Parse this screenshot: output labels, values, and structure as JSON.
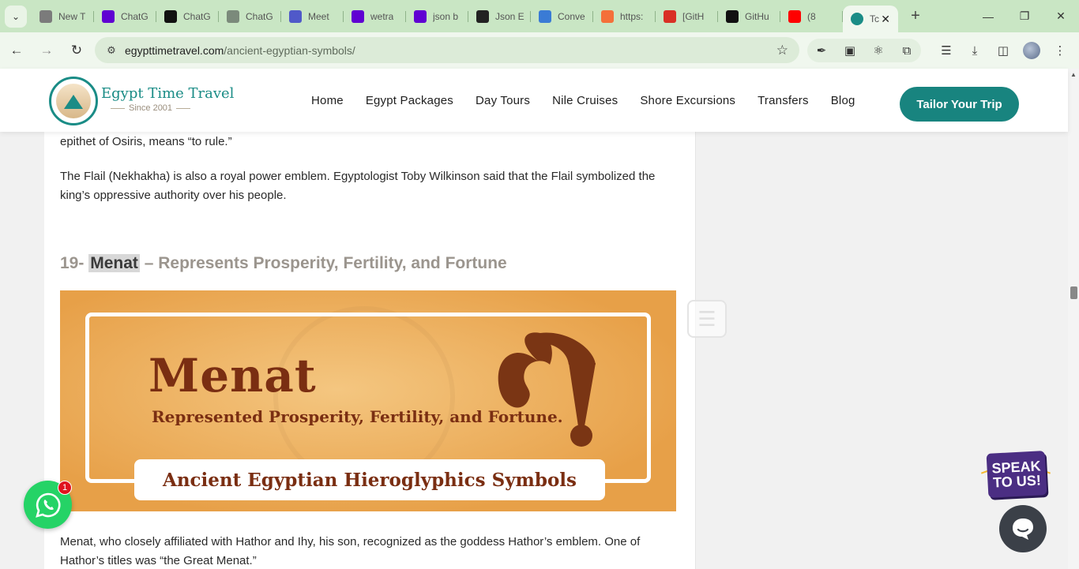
{
  "browser": {
    "tabs": [
      {
        "title": "New T",
        "icon": "chrome-icon",
        "color": "#7b7b7b"
      },
      {
        "title": "ChatG",
        "icon": "yahoo-icon",
        "color": "#6001d2"
      },
      {
        "title": "ChatG",
        "icon": "chatgpt-icon",
        "color": "#111111"
      },
      {
        "title": "ChatG",
        "icon": "chatgpt-icon",
        "color": "#7b8a7b"
      },
      {
        "title": "Meet",
        "icon": "teams-icon",
        "color": "#5059c9"
      },
      {
        "title": "wetra",
        "icon": "yahoo-icon",
        "color": "#6001d2"
      },
      {
        "title": "json b",
        "icon": "yahoo-icon",
        "color": "#6001d2"
      },
      {
        "title": "Json E",
        "icon": "json-editor-icon",
        "color": "#222222"
      },
      {
        "title": "Conve",
        "icon": "converter-icon",
        "color": "#3a7bd5"
      },
      {
        "title": "https:",
        "icon": "orange-circle-icon",
        "color": "#f4703a"
      },
      {
        "title": "[GitH",
        "icon": "gmail-icon",
        "color": "#d93025"
      },
      {
        "title": "GitHu",
        "icon": "github-icon",
        "color": "#111111"
      },
      {
        "title": "(8",
        "icon": "youtube-icon",
        "color": "#ff0000"
      }
    ],
    "active_tab": {
      "title": "Tc",
      "icon": "egypt-time-travel-favicon"
    },
    "url_domain": "egypttimetravel.com",
    "url_path": "/ancient-egyptian-symbols/"
  },
  "site": {
    "logo_title": "Egypt Time Travel",
    "logo_since": "Since 2001",
    "nav": [
      "Home",
      "Egypt Packages",
      "Day Tours",
      "Nile Cruises",
      "Shore Excursions",
      "Transfers",
      "Blog"
    ],
    "cta": "Tailor Your Trip",
    "brand_color": "#18847f"
  },
  "article": {
    "para_top": "epithet of Osiris, means “to rule.”",
    "para_flail": "The Flail (Nekhakha) is also a royal power emblem. Egyptologist Toby Wilkinson said that the Flail symbolized the king’s oppressive authority over his people.",
    "heading_prefix": "19-",
    "heading_highlight": "Menat",
    "heading_rest": "– Represents Prosperity, Fertility, and Fortune",
    "image": {
      "title": "Menat",
      "subtitle": "Represented Prosperity, Fertility, and Fortune.",
      "banner": "Ancient Egyptian Hieroglyphics Symbols"
    },
    "para_menat": "Menat, who closely affiliated with Hathor and Ihy, his son, recognized as the goddess Hathor’s emblem. One of Hathor’s titles was “the Great Menat.”"
  },
  "widgets": {
    "whatsapp_badge": "1",
    "speak_line1": "SPEAK",
    "speak_line2": "TO US!"
  }
}
